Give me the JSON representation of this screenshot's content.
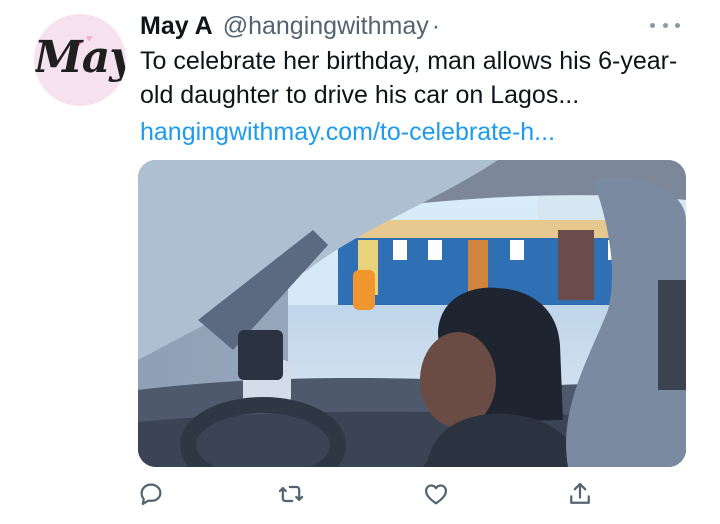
{
  "tweet": {
    "avatar_text": "May",
    "display_name": "May A",
    "handle": "@hangingwithmay",
    "separator": "·",
    "text": "To celebrate her birthday, man allows his 6-year-old daughter to drive his car on Lagos...",
    "link": "hangingwithmay.com/to-celebrate-h..."
  },
  "icons": {
    "more": "more-icon",
    "reply": "reply-icon",
    "retweet": "retweet-icon",
    "like": "like-icon",
    "share": "share-icon"
  },
  "colors": {
    "text": "#0f1419",
    "secondary": "#536471",
    "link": "#1d9bf0",
    "avatar_bg": "#f6e1ee"
  }
}
